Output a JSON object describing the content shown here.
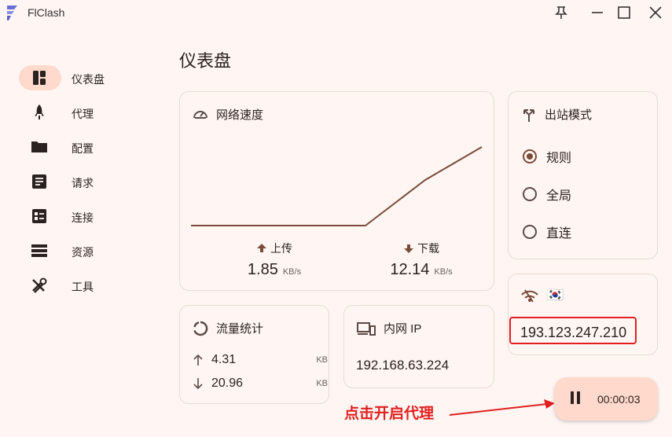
{
  "app": {
    "title": "FlClash"
  },
  "window_controls": [
    "pin-icon",
    "minimize-icon",
    "maximize-icon",
    "close-icon"
  ],
  "sidebar": {
    "items": [
      {
        "label": "仪表盘",
        "icon": "dashboard-icon",
        "active": true
      },
      {
        "label": "代理",
        "icon": "rocket-icon",
        "active": false
      },
      {
        "label": "配置",
        "icon": "folder-icon",
        "active": false
      },
      {
        "label": "请求",
        "icon": "request-icon",
        "active": false
      },
      {
        "label": "连接",
        "icon": "connections-icon",
        "active": false
      },
      {
        "label": "资源",
        "icon": "storage-icon",
        "active": false
      },
      {
        "label": "工具",
        "icon": "tools-icon",
        "active": false
      }
    ]
  },
  "page": {
    "title": "仪表盘"
  },
  "network_speed": {
    "title": "网络速度",
    "upload": {
      "label": "上传",
      "value": "1.85",
      "unit": "KB/s"
    },
    "download": {
      "label": "下载",
      "value": "12.14",
      "unit": "KB/s"
    },
    "line_color": "#7a4b38"
  },
  "outbound_mode": {
    "title": "出站模式",
    "options": [
      {
        "label": "规则",
        "checked": true
      },
      {
        "label": "全局",
        "checked": false
      },
      {
        "label": "直连",
        "checked": false
      }
    ]
  },
  "public_ip": {
    "flag": "🇰🇷",
    "value": "193.123.247.210"
  },
  "traffic": {
    "title": "流量统计",
    "up": {
      "value": "4.31",
      "unit": "KB"
    },
    "down": {
      "value": "20.96",
      "unit": "KB"
    }
  },
  "intranet_ip": {
    "title": "内网 IP",
    "value": "192.168.63.224"
  },
  "fab": {
    "time": "00:00:03"
  },
  "annotation": {
    "text": "点击开启代理",
    "color": "#e02020"
  },
  "colors": {
    "background": "#fff6f3",
    "accent": "#ffd9cc",
    "brown": "#7a4b38",
    "highlight_red": "#e02020"
  }
}
